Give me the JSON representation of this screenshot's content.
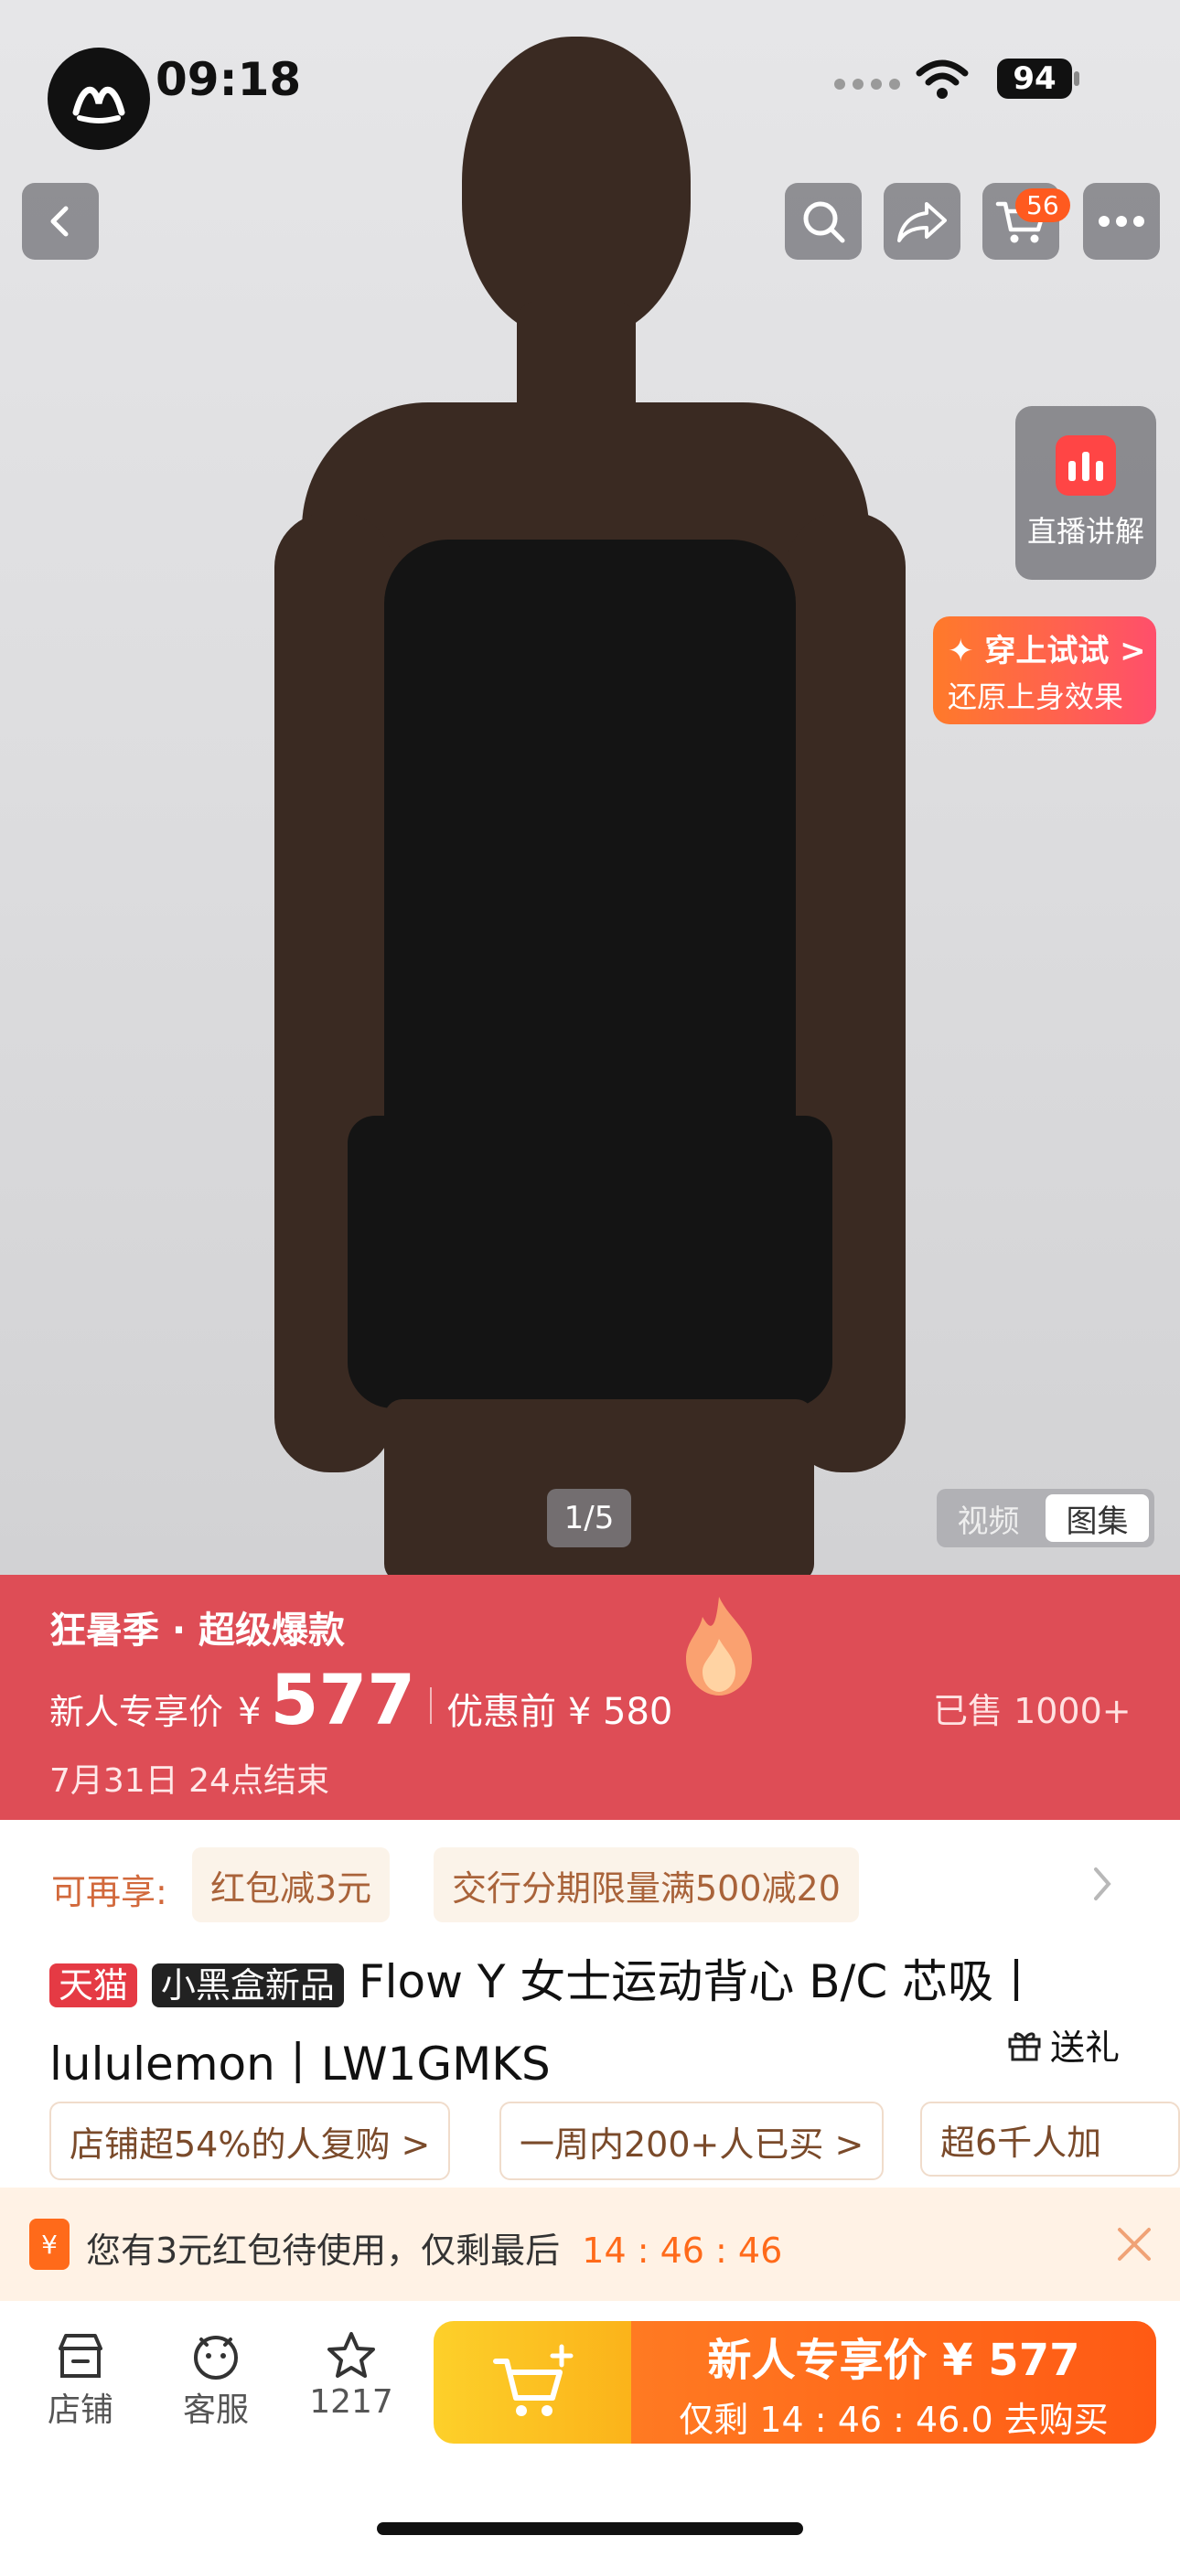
{
  "status_bar": {
    "time": "09:18",
    "battery": "94"
  },
  "topbar": {
    "cart_count": "56"
  },
  "side": {
    "live_label": "直播讲解",
    "tryon_title": "✦ 穿上试试 >",
    "tryon_sub": "还原上身效果"
  },
  "gallery": {
    "counter": "1/5",
    "tabs": [
      "视频",
      "图集"
    ],
    "selected_tab": "图集"
  },
  "promo": {
    "title": "狂暑季 · 超级爆款",
    "price_label": "新人专享价",
    "currency": "¥",
    "price": "577",
    "original_label": "优惠前 ¥ 580",
    "sold": "已售 1000+",
    "end_time": "7月31日 24点结束"
  },
  "offers": {
    "label": "可再享:",
    "items": [
      "红包减3元",
      "交行分期限量满500减20"
    ]
  },
  "product": {
    "tag_tmall": "天猫",
    "tag_box": "小黑盒新品",
    "title_line1": "Flow Y 女士运动背心 B/C 芯吸丨",
    "title_line2": "lululemon丨LW1GMKS",
    "gift_label": "送礼"
  },
  "highlights": [
    "店铺超54%的人复购 >",
    "一周内200+人已买 >",
    "超6千人加"
  ],
  "coupon_bar": {
    "text": "您有3元红包待使用，仅剩最后",
    "countdown": "14 : 46 : 46"
  },
  "bottom_tabs": [
    {
      "label": "店铺"
    },
    {
      "label": "客服"
    },
    {
      "label": "1217"
    }
  ],
  "buy_button": {
    "title": "新人专享价 ¥ 577",
    "subtitle": "仅剩 14 : 46 : 46.0 去购买"
  },
  "colors": {
    "promo_bg": "#de4d56",
    "accent_orange": "#ff6a1a",
    "cart_segment": "#fbc326"
  }
}
